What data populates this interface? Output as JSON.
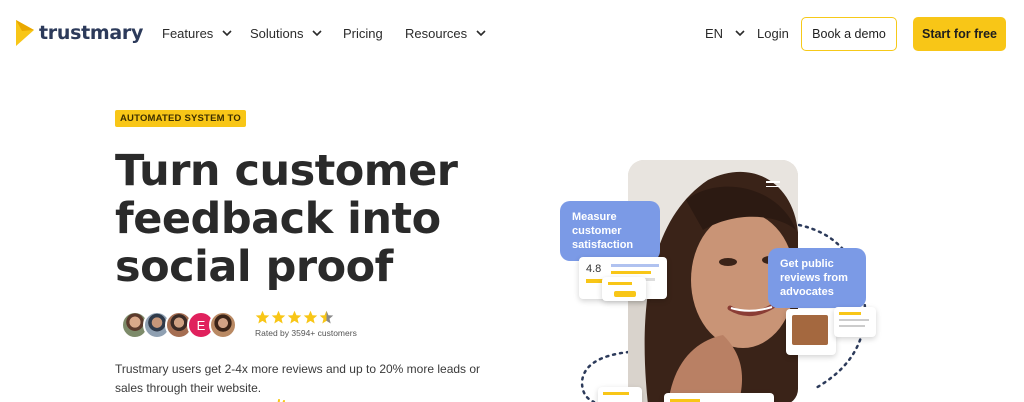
{
  "brand": {
    "name": "trustmary",
    "color": "#f8c617"
  },
  "nav": {
    "features": "Features",
    "solutions": "Solutions",
    "pricing": "Pricing",
    "resources": "Resources",
    "language": "EN",
    "login": "Login",
    "book_demo": "Book a demo",
    "start_free": "Start for free"
  },
  "hero": {
    "eyebrow": "AUTOMATED SYSTEM TO",
    "headline_line1": "Turn customer",
    "headline_line2": "feedback into",
    "headline_line3": "social proof",
    "rating_stars": 4.5,
    "rated_text": "Rated by 3594+ customers",
    "avatar_letter": "E",
    "subtext": "Trustmary users get 2-4x more reviews and up to 20% more leads or sales through their website."
  },
  "visual": {
    "bubble1": "Measure customer satisfaction",
    "bubble2": "Get public reviews from advocates",
    "score": "4.8"
  }
}
